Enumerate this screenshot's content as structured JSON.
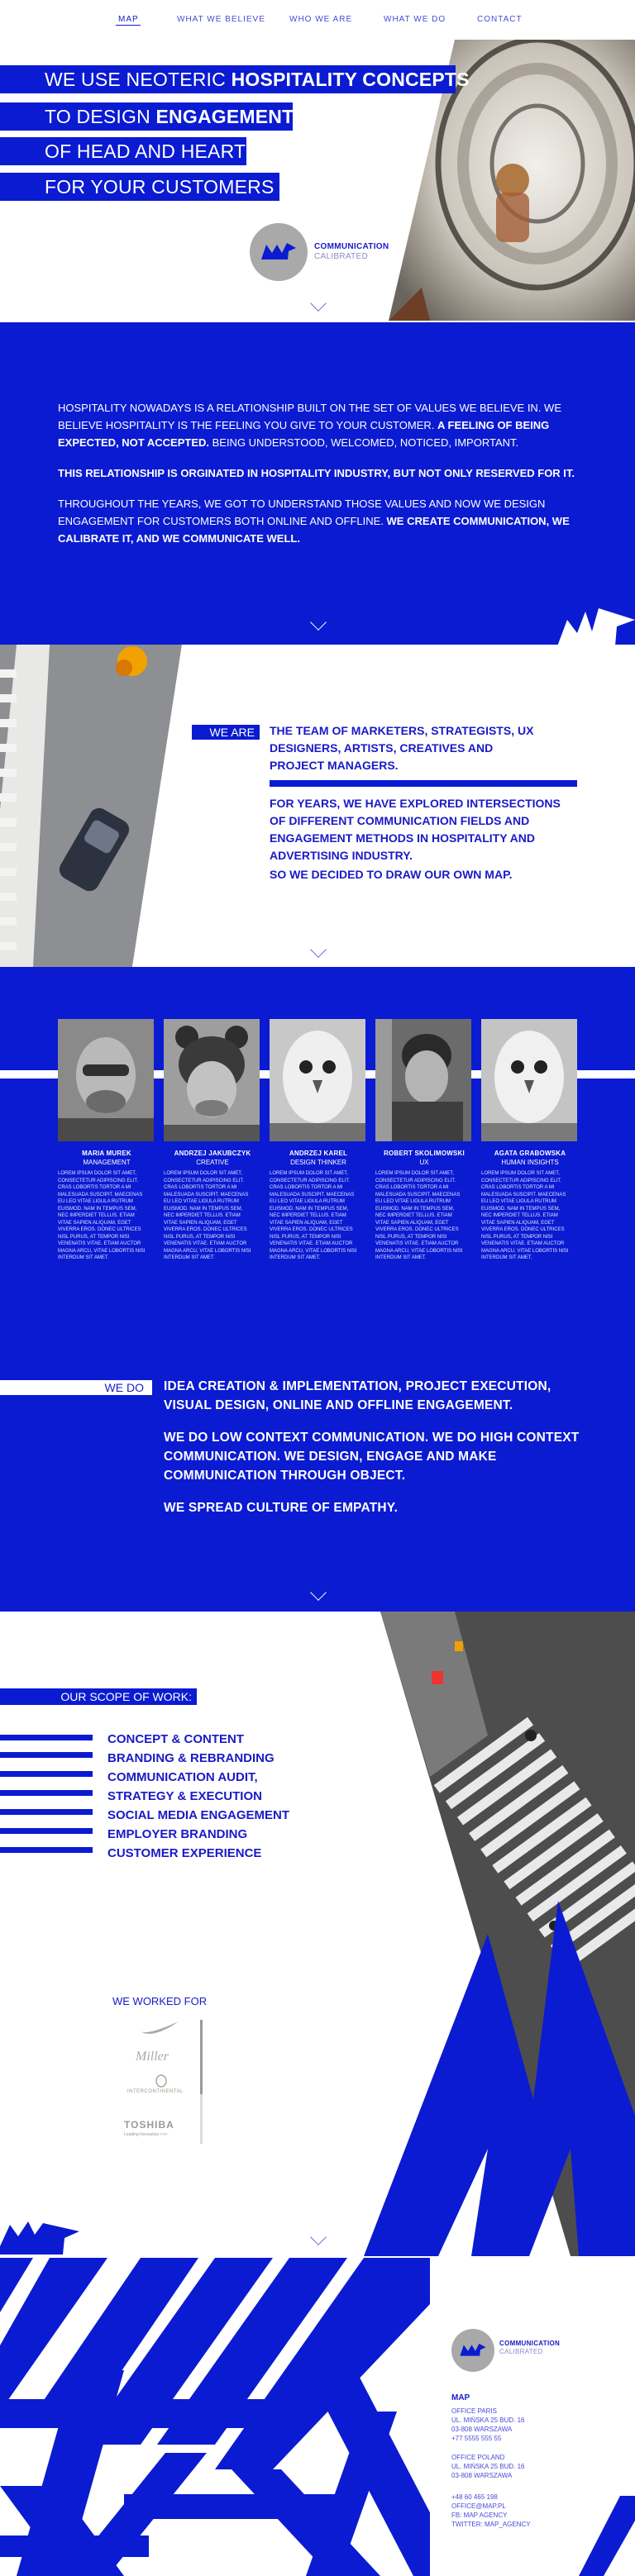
{
  "nav": {
    "items": [
      {
        "label": "MAP",
        "active": true
      },
      {
        "label": "WHAT WE BELIEVE",
        "active": false
      },
      {
        "label": "WHO WE ARE",
        "active": false
      },
      {
        "label": "WHAT WE DO",
        "active": false
      },
      {
        "label": "CONTACT",
        "active": false
      }
    ]
  },
  "hero": {
    "line1_a": "WE USE NEOTERIC ",
    "line1_b": "HOSPITALITY CONCEPTS",
    "line2_a": "TO DESIGN ",
    "line2_b": "ENGAGEMENT",
    "line3": "OF HEAD AND HEART",
    "line4": "FOR YOUR CUSTOMERS",
    "logo_title": "COMMUNICATION",
    "logo_sub": "CALIBRATED"
  },
  "intro": {
    "p1_a": "HOSPITALITY NOWADAYS IS A RELATIONSHIP BUILT ON THE SET OF VALUES WE BELIEVE IN. WE BELIEVE HOSPITALITY IS THE FEELING YOU GIVE TO YOUR CUSTOMER. ",
    "p1_b": "A FEELING OF BEING EXPECTED, NOT ACCEPTED.",
    "p1_c": " BEING UNDERSTOOD, WELCOMED, NOTICED, IMPORTANT.",
    "p2": "THIS RELATIONSHIP IS ORGINATED IN HOSPITALITY INDUSTRY, BUT NOT ONLY RESERVED FOR IT.",
    "p3_a": "THROUGHOUT THE YEARS, WE GOT TO UNDERSTAND THOSE VALUES AND NOW WE DESIGN ENGAGEMENT FOR CUSTOMERS BOTH ONLINE AND OFFLINE. ",
    "p3_b": "WE CREATE COMMUNICATION, WE CALIBRATE IT, AND WE COMMUNICATE WELL."
  },
  "we_are": {
    "label": "WE ARE",
    "p1": "THE TEAM OF MARKETERS, STRATEGISTS, UX DESIGNERS, ARTISTS, CREATIVES AND PROJECT MANAGERS.",
    "p2": "FOR YEARS, WE HAVE EXPLORED INTERSECTIONS OF DIFFERENT COMMUNICATION FIELDS AND ENGAGEMENT METHODS IN HOSPITALITY AND ADVERTISING INDUSTRY.",
    "p3": "SO WE DECIDED TO DRAW OUR OWN MAP."
  },
  "team": [
    {
      "name": "MARIA MUREK",
      "role": "MANAGEMENT",
      "bio": "LOREM IPSUM DOLOR SIT AMET, CONSECTETUR ADIPISCING ELIT. CRAS LOBORTIS TORTOR A MI MALESUADA SUSCIPIT. MAECENAS EU LEO VITAE LIGULA RUTRUM EUISMOD. NAM IN TEMPUS SEM, NEC IMPERDIET TELLUS. ETIAM VITAE SAPIEN ALIQUAM, EGET VIVERRA EROS. DONEC ULTRICES NISL PURUS, AT TEMPOR NISI VENENATIS VITAE. ETIAM AUCTOR MAGNA ARCU, VITAE LOBORTIS NISI INTERDUM SIT AMET."
    },
    {
      "name": "ANDRZEJ JAKUBCZYK",
      "role": "CREATIVE",
      "bio": "LOREM IPSUM DOLOR SIT AMET, CONSECTETUR ADIPISCING ELIT. CRAS LOBORTIS TORTOR A MI MALESUADA SUSCIPIT. MAECENAS EU LEO VITAE LIGULA RUTRUM EUISMOD. NAM IN TEMPUS SEM, NEC IMPERDIET TELLUS. ETIAM VITAE SAPIEN ALIQUAM, EGET VIVERRA EROS. DONEC ULTRICES NISL PURUS, AT TEMPOR NISI VENENATIS VITAE. ETIAM AUCTOR MAGNA ARCU, VITAE LOBORTIS NISI INTERDUM SIT AMET."
    },
    {
      "name": "ANDRZEJ KAREL",
      "role": "DESIGN THINKER",
      "bio": "LOREM IPSUM DOLOR SIT AMET, CONSECTETUR ADIPISCING ELIT. CRAS LOBORTIS TORTOR A MI MALESUADA SUSCIPIT. MAECENAS EU LEO VITAE LIGULA RUTRUM EUISMOD. NAM IN TEMPUS SEM, NEC IMPERDIET TELLUS. ETIAM VITAE SAPIEN ALIQUAM, EGET VIVERRA EROS. DONEC ULTRICES NISL PURUS, AT TEMPOR NISI VENENATIS VITAE. ETIAM AUCTOR MAGNA ARCU, VITAE LOBORTIS NISI INTERDUM SIT AMET."
    },
    {
      "name": "ROBERT SKOLIMOWSKI",
      "role": "UX",
      "bio": "LOREM IPSUM DOLOR SIT AMET, CONSECTETUR ADIPISCING ELIT. CRAS LOBORTIS TORTOR A MI MALESUADA SUSCIPIT. MAECENAS EU LEO VITAE LIGULA RUTRUM EUISMOD. NAM IN TEMPUS SEM, NEC IMPERDIET TELLUS. ETIAM VITAE SAPIEN ALIQUAM, EGET VIVERRA EROS. DONEC ULTRICES NISL PURUS, AT TEMPOR NISI VENENATIS VITAE. ETIAM AUCTOR MAGNA ARCU, VITAE LOBORTIS NISI INTERDUM SIT AMET."
    },
    {
      "name": "AGATA GRABOWSKA",
      "role": "HUMAN INSIGHTS",
      "bio": "LOREM IPSUM DOLOR SIT AMET, CONSECTETUR ADIPISCING ELIT. CRAS LOBORTIS TORTOR A MI MALESUADA SUSCIPIT. MAECENAS EU LEO VITAE LIGULA RUTRUM EUISMOD. NAM IN TEMPUS SEM, NEC IMPERDIET TELLUS. ETIAM VITAE SAPIEN ALIQUAM, EGET VIVERRA EROS. DONEC ULTRICES NISL PURUS, AT TEMPOR NISI VENENATIS VITAE. ETIAM AUCTOR MAGNA ARCU, VITAE LOBORTIS NISI INTERDUM SIT AMET."
    }
  ],
  "we_do": {
    "label": "WE DO",
    "p1": "IDEA CREATION & IMPLEMENTATION, PROJECT EXECUTION, VISUAL DESIGN, ONLINE AND OFFLINE ENGAGEMENT.",
    "p2": "WE DO LOW CONTEXT COMMUNICATION. WE DO HIGH CONTEXT COMMUNICATION. WE DESIGN, ENGAGE AND MAKE COMMUNICATION THROUGH OBJECT.",
    "p3": "WE SPREAD CULTURE OF EMPATHY."
  },
  "scope": {
    "label": "OUR SCOPE OF WORK:",
    "items": [
      "CONCEPT & CONTENT",
      "BRANDING & REBRANDING",
      "COMMUNICATION AUDIT,",
      "STRATEGY & EXECUTION",
      "SOCIAL MEDIA ENGAGEMENT",
      "EMPLOYER BRANDING",
      "CUSTOMER EXPERIENCE"
    ]
  },
  "clients": {
    "label": "WE WORKED FOR",
    "logos": [
      "Miller",
      "INTERCONTINENTAL",
      "TOSHIBA",
      "Leading Innovation >>>"
    ]
  },
  "footer": {
    "logo_title": "COMMUNICATION",
    "logo_sub": "CALIBRATED",
    "brand": "MAP",
    "office1": [
      "OFFICE PARIS",
      "UL. MIŃSKA 25 BUD. 16",
      "03-808 WARSZAWA",
      "+77 5555 555 55"
    ],
    "office2": [
      "OFFICE POLAND",
      "UL. MIŃSKA 25 BUD. 16",
      "03-808 WARSZAWA"
    ],
    "contacts": [
      "+48 60 465 198",
      "OFFICE@MAP.PL",
      "FB: MAP AGENCY",
      "TWITTER: MAP_AGENCY"
    ]
  },
  "colors": {
    "brand_blue": "#0b1bd1",
    "text_blue": "#1a1ac8",
    "logo_grey": "#a9a9a9"
  }
}
